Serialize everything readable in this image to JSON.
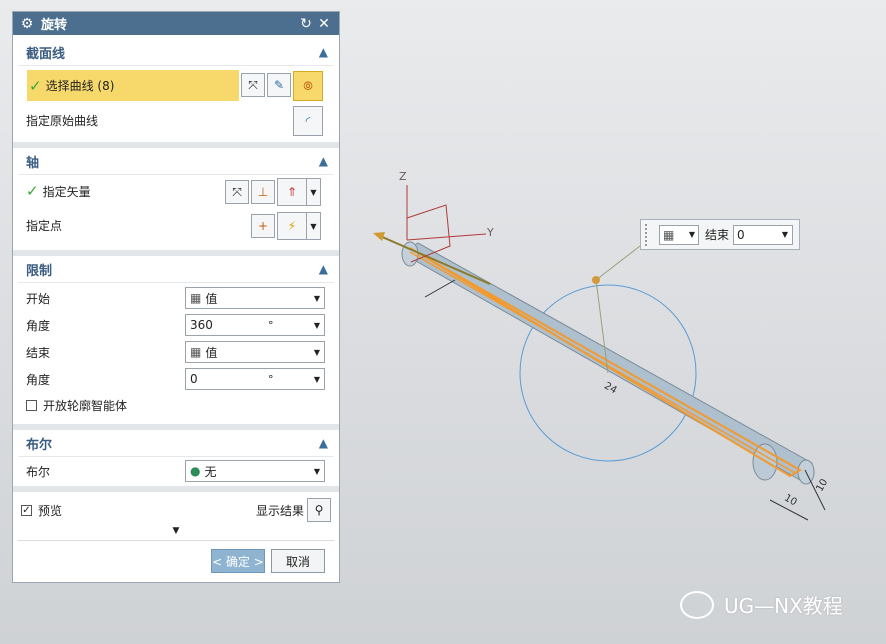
{
  "dialog": {
    "title": "旋转",
    "section_curve": {
      "header": "截面线",
      "select_curve_label": "选择曲线 (8)",
      "specify_origin_label": "指定原始曲线"
    },
    "section_axis": {
      "header": "轴",
      "specify_vector_label": "指定矢量",
      "specify_point_label": "指定点"
    },
    "section_limits": {
      "header": "限制",
      "start_label": "开始",
      "start_value": "值",
      "start_angle_label": "角度",
      "start_angle_value": "360",
      "start_angle_unit": "°",
      "end_label": "结束",
      "end_value": "值",
      "end_angle_label": "角度",
      "end_angle_value": "0",
      "end_angle_unit": "°",
      "open_profile_label": "开放轮廓智能体"
    },
    "section_boolean": {
      "header": "布尔",
      "boolean_label": "布尔",
      "boolean_value": "无"
    },
    "preview_label": "预览",
    "show_result_label": "显示结果",
    "ok_label": "< 确定 >",
    "cancel_label": "取消"
  },
  "viewport": {
    "end_toolbar_label": "结束",
    "end_toolbar_value": "0",
    "axis_z": "Z",
    "axis_y": "Y",
    "dim_a": "10",
    "dim_b": "10",
    "dim_c": "24",
    "watermark": "UG—NX教程"
  },
  "colors": {
    "title_bar": "#4c6f8f",
    "section_header": "#3b5d82",
    "selection_highlight": "#f7d96b",
    "shaft": "#aebfcd",
    "curve_highlight": "#f39a2e",
    "circle": "#5b9bd5"
  }
}
